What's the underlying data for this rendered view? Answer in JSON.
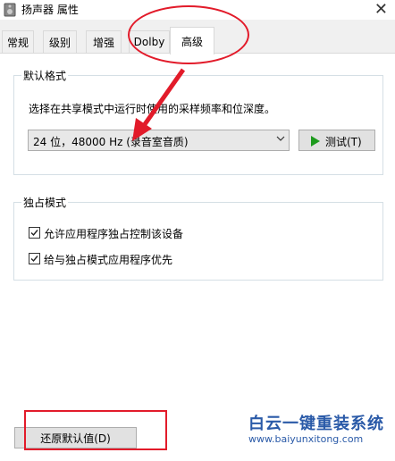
{
  "window": {
    "title": "扬声器 属性",
    "close_glyph": "✕"
  },
  "tabs": [
    {
      "label": "常规"
    },
    {
      "label": "级别"
    },
    {
      "label": "增强"
    },
    {
      "label": "Dolby"
    },
    {
      "label": "高级",
      "active": true
    }
  ],
  "default_format": {
    "group_label": "默认格式",
    "description": "选择在共享模式中运行时使用的采样频率和位深度。",
    "selected_value": "24 位，48000 Hz (录音室音质)",
    "test_button": "测试(T)"
  },
  "exclusive_mode": {
    "group_label": "独占模式",
    "options": [
      {
        "label": "允许应用程序独占控制该设备",
        "checked": true
      },
      {
        "label": "给与独占模式应用程序优先",
        "checked": true
      }
    ]
  },
  "restore_button": "还原默认值(D)",
  "watermark": {
    "title": "白云一键重装系统",
    "url": "www.baiyunxitong.com"
  },
  "colors": {
    "annotation": "#e21b2a",
    "play_icon": "#1e9b1e",
    "watermark": "#2a5aa8"
  }
}
